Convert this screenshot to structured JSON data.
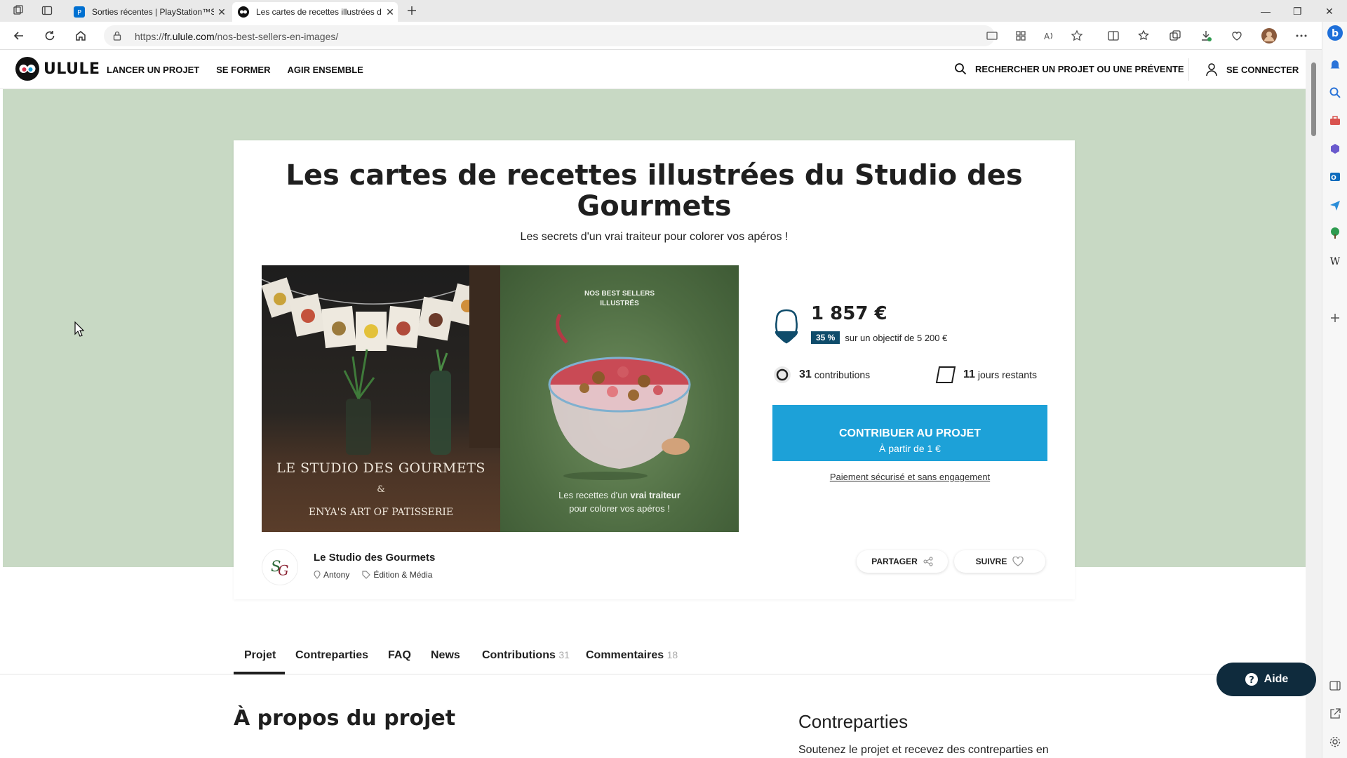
{
  "browser": {
    "tabs": [
      {
        "title": "Sorties récentes | PlayStation™St",
        "active": false
      },
      {
        "title": "Les cartes de recettes illustrées d",
        "active": true
      }
    ],
    "url_prefix": "https://",
    "url_host": "fr.ulule.com",
    "url_path": "/nos-best-sellers-en-images/"
  },
  "header": {
    "logo_text": "ULULE",
    "nav": [
      "LANCER UN PROJET",
      "SE FORMER",
      "AGIR ENSEMBLE"
    ],
    "search_label": "RECHERCHER UN PROJET OU UNE PRÉVENTE",
    "login_label": "SE CONNECTER"
  },
  "project": {
    "title": "Les cartes de recettes illustrées du Studio des Gourmets",
    "subtitle": "Les secrets d'un vrai traiteur pour colorer vos apéros !",
    "image": {
      "left_brand": "LE STUDIO DES GOURMETS",
      "left_amp": "&",
      "left_partner": "ENYA'S ART OF PATISSERIE",
      "right_badge": "NOS BEST SELLERS\nILLUSTRÉS",
      "right_caption_1": "Les recettes d'un",
      "right_caption_bold": "vrai traiteur",
      "right_caption_2": "pour colorer vos apéros !"
    },
    "amount": "1 857 €",
    "percent": "35 %",
    "progress_fraction": 0.35,
    "goal_text": "sur un objectif de 5 200 €",
    "contributions_count": "31",
    "contributions_label": "contributions",
    "days_count": "11",
    "days_label": "jours restants",
    "cta_line1": "CONTRIBUER AU PROJET",
    "cta_line2": "À partir de 1 €",
    "secure_text": "Paiement sécurisé et sans engagement",
    "owner_name": "Le Studio des Gourmets",
    "owner_location": "Antony",
    "owner_category": "Édition & Média",
    "share_label": "PARTAGER",
    "follow_label": "SUIVRE"
  },
  "tabs": [
    {
      "label": "Projet",
      "count": ""
    },
    {
      "label": "Contreparties",
      "count": ""
    },
    {
      "label": "FAQ",
      "count": ""
    },
    {
      "label": "News",
      "count": ""
    },
    {
      "label": "Contributions",
      "count": "31"
    },
    {
      "label": "Commentaires",
      "count": "18"
    }
  ],
  "content": {
    "about_title": "À propos du projet",
    "rewards_title": "Contreparties",
    "rewards_text": "Soutenez le projet et recevez des contreparties en"
  },
  "help_label": "Aide",
  "colors": {
    "hero_bg": "#c8d9c4",
    "cta": "#1da1d8",
    "percent_badge": "#0f4c6b",
    "help_button": "#0f2b3d"
  }
}
